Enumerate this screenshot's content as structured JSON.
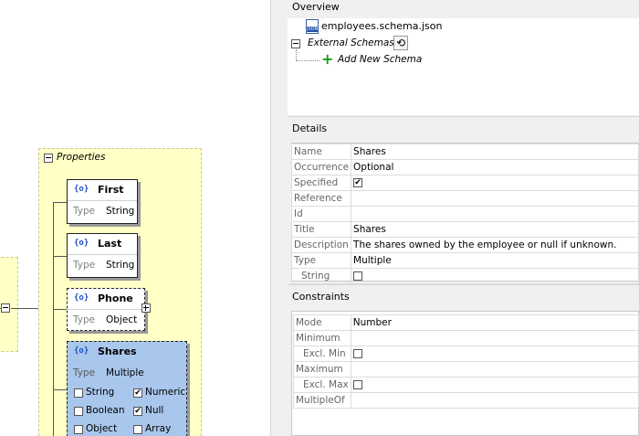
{
  "overview": {
    "title": "Overview",
    "file_name": "employees.schema.json",
    "file_icon": "JSON",
    "external_schemas_label": "External Schemas",
    "add_new_schema_label": "Add New Schema"
  },
  "details": {
    "title": "Details",
    "rows": [
      {
        "key": "Name",
        "value": "Shares"
      },
      {
        "key": "Occurrence",
        "value": "Optional"
      },
      {
        "key": "Specified",
        "value": "✔"
      },
      {
        "key": "Reference",
        "value": ""
      },
      {
        "key": "Id",
        "value": ""
      },
      {
        "key": "Title",
        "value": "Shares"
      },
      {
        "key": "Description",
        "value": "The shares owned by the employee or null if unknown."
      },
      {
        "key": "Type",
        "value": "Multiple"
      },
      {
        "key": "String",
        "value": ""
      }
    ]
  },
  "constraints": {
    "title": "Constraints",
    "rows": [
      {
        "key": "Mode",
        "value": "Number"
      },
      {
        "key": "Minimum",
        "value": ""
      },
      {
        "key": "Excl. Min",
        "value": ""
      },
      {
        "key": "Maximum",
        "value": ""
      },
      {
        "key": "Excl. Max",
        "value": ""
      },
      {
        "key": "MultipleOf",
        "value": ""
      }
    ]
  },
  "diagram": {
    "properties_label": "Properties",
    "nodes": [
      {
        "name": "First",
        "type_label": "Type",
        "type": "String"
      },
      {
        "name": "Last",
        "type_label": "Type",
        "type": "String"
      },
      {
        "name": "Phone",
        "type_label": "Type",
        "type": "Object"
      },
      {
        "name": "Shares",
        "type_label": "Type",
        "type": "Multiple"
      }
    ],
    "shares_types": [
      {
        "label": "String",
        "checked": false
      },
      {
        "label": "Numeric",
        "checked": true
      },
      {
        "label": "Boolean",
        "checked": false
      },
      {
        "label": "Null",
        "checked": true
      },
      {
        "label": "Object",
        "checked": false
      },
      {
        "label": "Array",
        "checked": false
      }
    ],
    "object_icon": "{o}",
    "check_mark": "✔"
  },
  "colors": {
    "selected_node": "#a9c7ec",
    "properties_bg": "#ffffc6",
    "add_icon": "#1a9a1a"
  }
}
